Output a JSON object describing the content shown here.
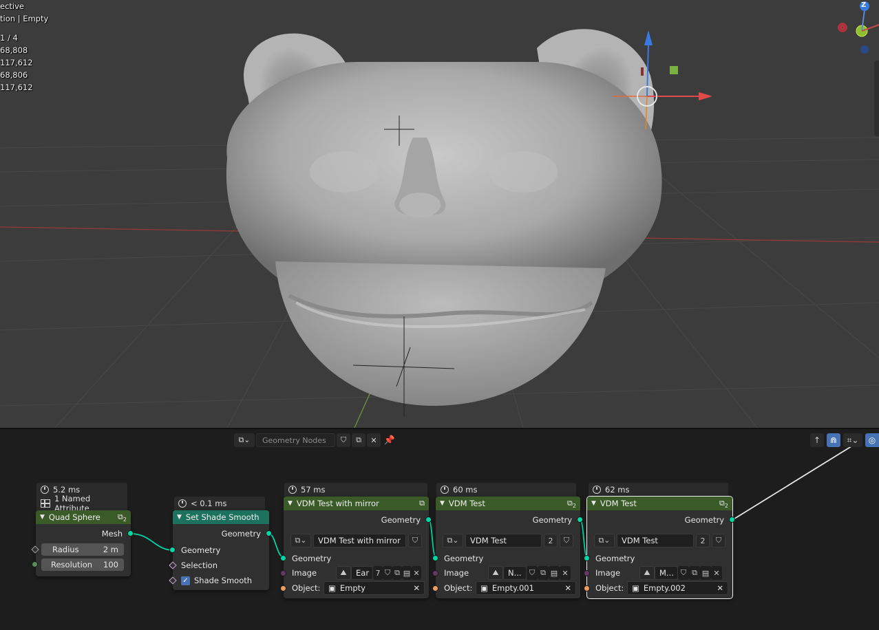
{
  "viewport": {
    "stats": {
      "line1": "ective",
      "line2": "tion | Empty",
      "objects": "1 / 4",
      "vertices": "68,808",
      "edges": "117,612",
      "faces": "68,806",
      "triangles": "117,612"
    },
    "gizmo": {
      "z_label": "Z"
    }
  },
  "node_editor": {
    "header": {
      "node_group_name": "Geometry Nodes"
    },
    "nodes": [
      {
        "timing": "5.2 ms",
        "extra": "1 Named Attribute",
        "title": "Quad Sphere",
        "user_count": "2",
        "outputs": [
          "Mesh"
        ],
        "radius_label": "Radius",
        "radius_value": "2 m",
        "resolution_label": "Resolution",
        "resolution_value": "100"
      },
      {
        "timing": "< 0.1 ms",
        "title": "Set Shade Smooth",
        "outputs": [
          "Geometry"
        ],
        "inputs": [
          "Geometry",
          "Selection",
          "Shade Smooth"
        ],
        "shade_smooth_checked": true
      },
      {
        "timing": "57 ms",
        "title": "VDM Test with mirror",
        "output": "Geometry",
        "group": "VDM Test with mirror",
        "input_geometry": "Geometry",
        "image_label": "Image",
        "image_name": "Ear",
        "image_users": "7",
        "object_label": "Object:",
        "object_name": "Empty"
      },
      {
        "timing": "60 ms",
        "title": "VDM Test",
        "user_count": "2",
        "output": "Geometry",
        "group": "VDM Test",
        "group_users": "2",
        "input_geometry": "Geometry",
        "image_label": "Image",
        "image_name": "N...",
        "object_label": "Object:",
        "object_name": "Empty.001"
      },
      {
        "timing": "62 ms",
        "title": "VDM Test",
        "user_count": "2",
        "output": "Geometry",
        "group": "VDM Test",
        "group_users": "2",
        "input_geometry": "Geometry",
        "image_label": "Image",
        "image_name": "M...",
        "object_label": "Object:",
        "object_name": "Empty.002"
      }
    ]
  },
  "colors": {
    "socket_geometry": "#00d6a3",
    "geometry_node_header": "#3a5a28",
    "set_shade_header": "#1d725e",
    "active_button": "#4772b3"
  }
}
